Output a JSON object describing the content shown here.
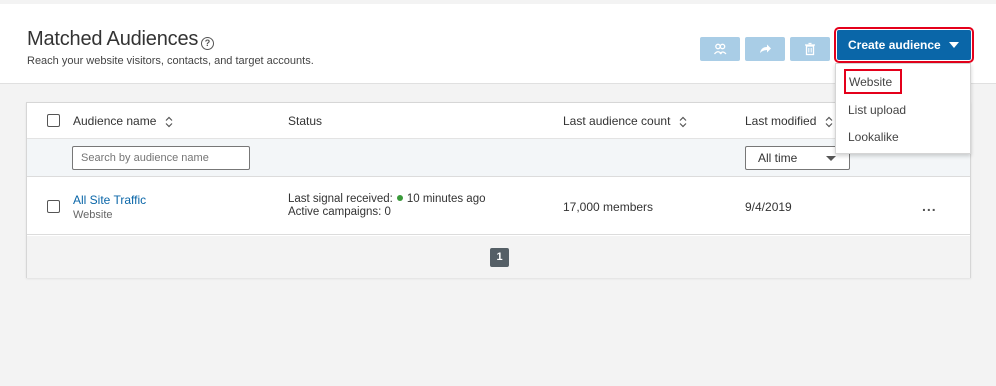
{
  "header": {
    "title": "Matched Audiences",
    "help_icon": "?",
    "subtitle": "Reach your website visitors, contacts, and target accounts.",
    "icon_buttons": [
      "people-icon",
      "share-icon",
      "trash-icon"
    ],
    "create_button_label": "Create audience"
  },
  "dropdown": {
    "items": [
      "Website",
      "List upload",
      "Lookalike"
    ]
  },
  "table": {
    "columns": [
      "Audience name",
      "Status",
      "Last audience count",
      "Last modified"
    ],
    "search_placeholder": "Search by audience name",
    "date_filter": "All time",
    "rows": [
      {
        "name": "All Site Traffic",
        "type": "Website",
        "status_signal_label": "Last signal received:",
        "status_signal_time": "10 minutes ago",
        "status_campaigns": "Active campaigns: 0",
        "count": "17,000 members",
        "modified": "9/4/2019",
        "more": "..."
      }
    ],
    "current_page": "1"
  },
  "colors": {
    "accent": "#0a66a8",
    "disabled_button": "#a9cde6",
    "highlight": "#e4001b",
    "signal_dot": "#3a9a3a"
  }
}
